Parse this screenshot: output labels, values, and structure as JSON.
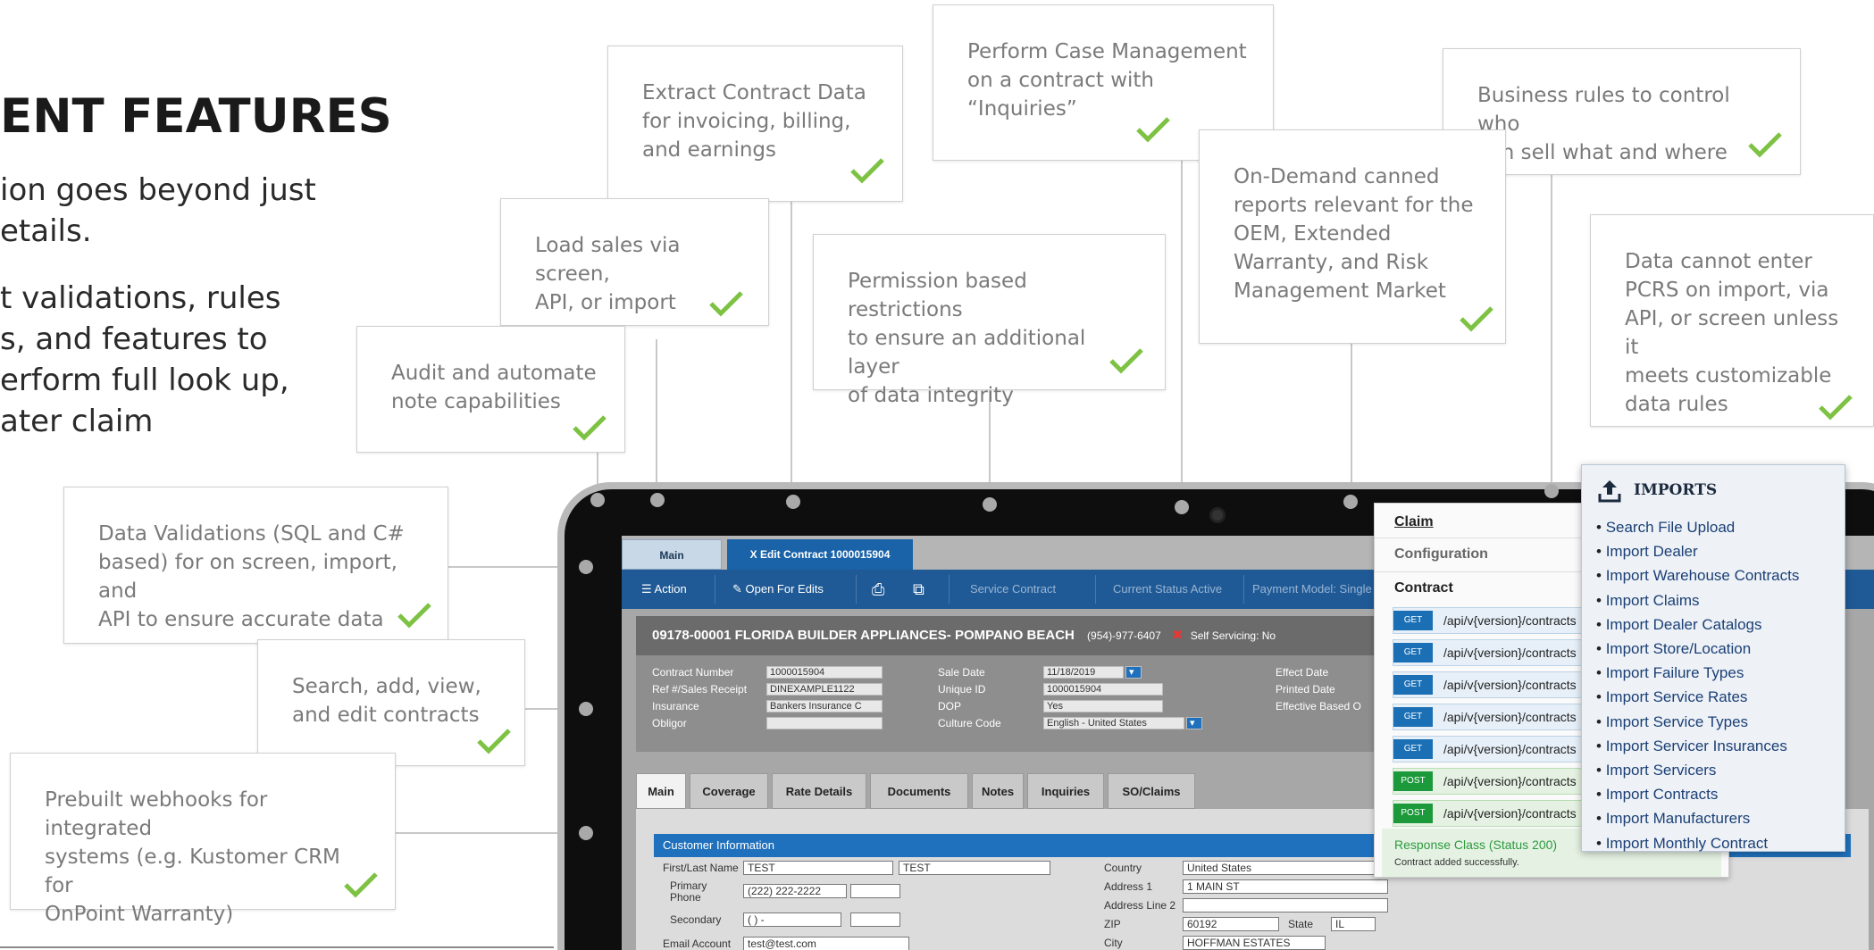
{
  "slide": {
    "heading": "ENT FEATURES",
    "paragraph1": [
      "ion goes beyond just",
      "etails."
    ],
    "paragraph2": [
      "t validations, rules",
      "s, and features to",
      "erform full look up,",
      "ater claim"
    ]
  },
  "callouts": {
    "extract": "Extract Contract Data\nfor invoicing, billing,\nand earnings",
    "case_mgmt": "Perform Case Management\non a contract with\n“Inquiries”",
    "business_rules": "Business rules to control who\ncan sell what and where",
    "load_sales": "Load sales via screen,\nAPI, or import",
    "permissions": "Permission based restrictions\nto ensure an additional layer\nof data integrity",
    "reports": "On-Demand canned\nreports relevant for the\nOEM, Extended\nWarranty, and Risk\nManagement Market",
    "pcrs": "Data cannot enter\nPCRS on import, via\nAPI, or screen unless it\nmeets customizable\ndata rules",
    "audit": "Audit and automate\nnote capabilities",
    "validations": "Data Validations (SQL and C#\nbased) for on screen, import, and\nAPI to ensure accurate data",
    "search": "Search, add, view,\nand edit contracts",
    "webhooks": "Prebuilt webhooks for integrated\nsystems (e.g. Kustomer CRM for\nOnPoint Warranty)"
  },
  "app": {
    "tabs": {
      "main": "Main",
      "edit": "X  Edit Contract 1000015904"
    },
    "toolbar": {
      "action": "☰  Action",
      "open_for_edits": "✎  Open For Edits",
      "service_contract": "Service Contract",
      "status": "Current Status Active",
      "payment": "Payment Model: Single"
    },
    "contract_header": "09178-00001    FLORIDA BUILDER APPLIANCES- POMPANO BEACH",
    "phone": "(954)-977-6407",
    "self_servicing": "Self Servicing: No",
    "fields": {
      "contract_number_label": "Contract Number",
      "contract_number": "1000015904",
      "ref_label": "Ref #/Sales Receipt",
      "ref": "DINEXAMPLE1122",
      "insurance_label": "Insurance",
      "insurance": "Bankers Insurance C",
      "obligor_label": "Obligor",
      "sale_date_label": "Sale Date",
      "sale_date": "11/18/2019",
      "unique_id_label": "Unique ID",
      "unique_id": "1000015904",
      "dop_label": "DOP",
      "dop": "Yes",
      "culture_label": "Culture Code",
      "culture": "English - United States",
      "effect_date_label": "Effect Date",
      "printed_date_label": "Printed Date",
      "effective_based_label": "Effective Based O"
    },
    "subtabs": [
      "Main",
      "Coverage",
      "Rate Details",
      "Documents",
      "Notes",
      "Inquiries",
      "SO/Claims"
    ],
    "customer_info": {
      "title": "Customer Information",
      "first_last_label": "First/Last Name",
      "first": "TEST",
      "last": "TEST",
      "primary_phone_label": "Primary\nPhone",
      "primary_phone": "(222) 222-2222",
      "secondary_label": "Secondary",
      "secondary": "(    )     -",
      "email_label": "Email Account",
      "email": "test@test.com",
      "country_label": "Country",
      "country": "United States",
      "address1_label": "Address 1",
      "address1": "1 MAIN ST",
      "address2_label": "Address Line 2",
      "zip_label": "ZIP",
      "zip": "60192",
      "state_label": "State",
      "state": "IL",
      "city_label": "City",
      "city": "HOFFMAN ESTATES"
    }
  },
  "api": {
    "claim": "Claim",
    "configuration": "Configuration",
    "contract": "Contract",
    "endpoints": [
      {
        "method": "GET",
        "path": "/api/v{version}/contracts"
      },
      {
        "method": "GET",
        "path": "/api/v{version}/contracts"
      },
      {
        "method": "GET",
        "path": "/api/v{version}/contracts"
      },
      {
        "method": "GET",
        "path": "/api/v{version}/contracts"
      },
      {
        "method": "GET",
        "path": "/api/v{version}/contracts"
      },
      {
        "method": "POST",
        "path": "/api/v{version}/contracts"
      },
      {
        "method": "POST",
        "path": "/api/v{version}/contracts"
      }
    ],
    "response_class": "Response Class (Status 200)",
    "response_message": "Contract added successfully."
  },
  "imports": {
    "title": "IMPORTS",
    "icon": "upload-icon",
    "items": [
      "Search File Upload",
      "Import Dealer",
      "Import Warehouse Contracts",
      "Import Claims",
      "Import Dealer Catalogs",
      "Import Store/Location",
      "Import Failure Types",
      "Import Service Rates",
      "Import Service Types",
      "Import Servicer Insurances",
      "Import Servicers",
      "Import Contracts",
      "Import Manufacturers",
      "Import Monthly Contract"
    ]
  },
  "colors": {
    "check": "#7dc242",
    "toolbar": "#1f5a96",
    "tab_active": "#1a63a8",
    "link": "#1b3f75"
  }
}
